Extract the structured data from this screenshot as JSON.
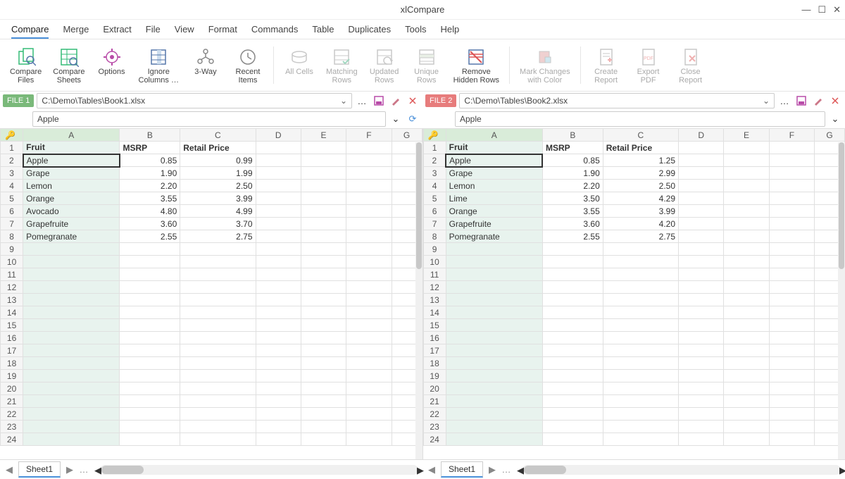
{
  "app": {
    "title": "xlCompare"
  },
  "menubar": [
    "Compare",
    "Merge",
    "Extract",
    "File",
    "View",
    "Format",
    "Commands",
    "Table",
    "Duplicates",
    "Tools",
    "Help"
  ],
  "ribbon": [
    {
      "id": "compare-files",
      "l1": "Compare",
      "l2": "Files",
      "dim": false
    },
    {
      "id": "compare-sheets",
      "l1": "Compare",
      "l2": "Sheets",
      "dim": false
    },
    {
      "id": "options",
      "l1": "Options",
      "l2": "",
      "dim": false
    },
    {
      "id": "ignore-columns",
      "l1": "Ignore",
      "l2": "Columns …",
      "dim": false
    },
    {
      "id": "three-way",
      "l1": "3-Way",
      "l2": "",
      "dim": false
    },
    {
      "id": "recent-items",
      "l1": "Recent",
      "l2": "Items",
      "dim": false
    },
    {
      "sep": true
    },
    {
      "id": "all-cells",
      "l1": "All Cells",
      "l2": "",
      "dim": true
    },
    {
      "id": "matching-rows",
      "l1": "Matching",
      "l2": "Rows",
      "dim": true
    },
    {
      "id": "updated-rows",
      "l1": "Updated",
      "l2": "Rows",
      "dim": true
    },
    {
      "id": "unique-rows",
      "l1": "Unique",
      "l2": "Rows",
      "dim": true
    },
    {
      "id": "remove-hidden",
      "l1": "Remove",
      "l2": "Hidden Rows",
      "dim": false
    },
    {
      "sep": true
    },
    {
      "id": "mark-changes",
      "l1": "Mark Changes",
      "l2": "with Color",
      "dim": true
    },
    {
      "sep": true
    },
    {
      "id": "create-report",
      "l1": "Create",
      "l2": "Report",
      "dim": true
    },
    {
      "id": "export-pdf",
      "l1": "Export",
      "l2": "PDF",
      "dim": true
    },
    {
      "id": "close-report",
      "l1": "Close",
      "l2": "Report",
      "dim": true
    }
  ],
  "files": {
    "left": {
      "badge": "FILE 1",
      "path": "C:\\Demo\\Tables\\Book1.xlsx",
      "formula": "Apple"
    },
    "right": {
      "badge": "FILE 2",
      "path": "C:\\Demo\\Tables\\Book2.xlsx",
      "formula": "Apple"
    }
  },
  "columns": [
    "A",
    "B",
    "C",
    "D",
    "E",
    "F",
    "G"
  ],
  "left_data": {
    "headers": [
      "Fruit",
      "MSRP",
      "Retail Price"
    ],
    "rows": [
      [
        "Apple",
        "0.85",
        "0.99"
      ],
      [
        "Grape",
        "1.90",
        "1.99"
      ],
      [
        "Lemon",
        "2.20",
        "2.50"
      ],
      [
        "Orange",
        "3.55",
        "3.99"
      ],
      [
        "Avocado",
        "4.80",
        "4.99"
      ],
      [
        "Grapefruite",
        "3.60",
        "3.70"
      ],
      [
        "Pomegranate",
        "2.55",
        "2.75"
      ]
    ]
  },
  "right_data": {
    "headers": [
      "Fruit",
      "MSRP",
      "Retail Price"
    ],
    "rows": [
      [
        "Apple",
        "0.85",
        "1.25"
      ],
      [
        "Grape",
        "1.90",
        "2.99"
      ],
      [
        "Lemon",
        "2.20",
        "2.50"
      ],
      [
        "Lime",
        "3.50",
        "4.29"
      ],
      [
        "Orange",
        "3.55",
        "3.99"
      ],
      [
        "Grapefruite",
        "3.60",
        "4.20"
      ],
      [
        "Pomegranate",
        "2.55",
        "2.75"
      ]
    ]
  },
  "sheet_tab": "Sheet1",
  "row_count": 24
}
